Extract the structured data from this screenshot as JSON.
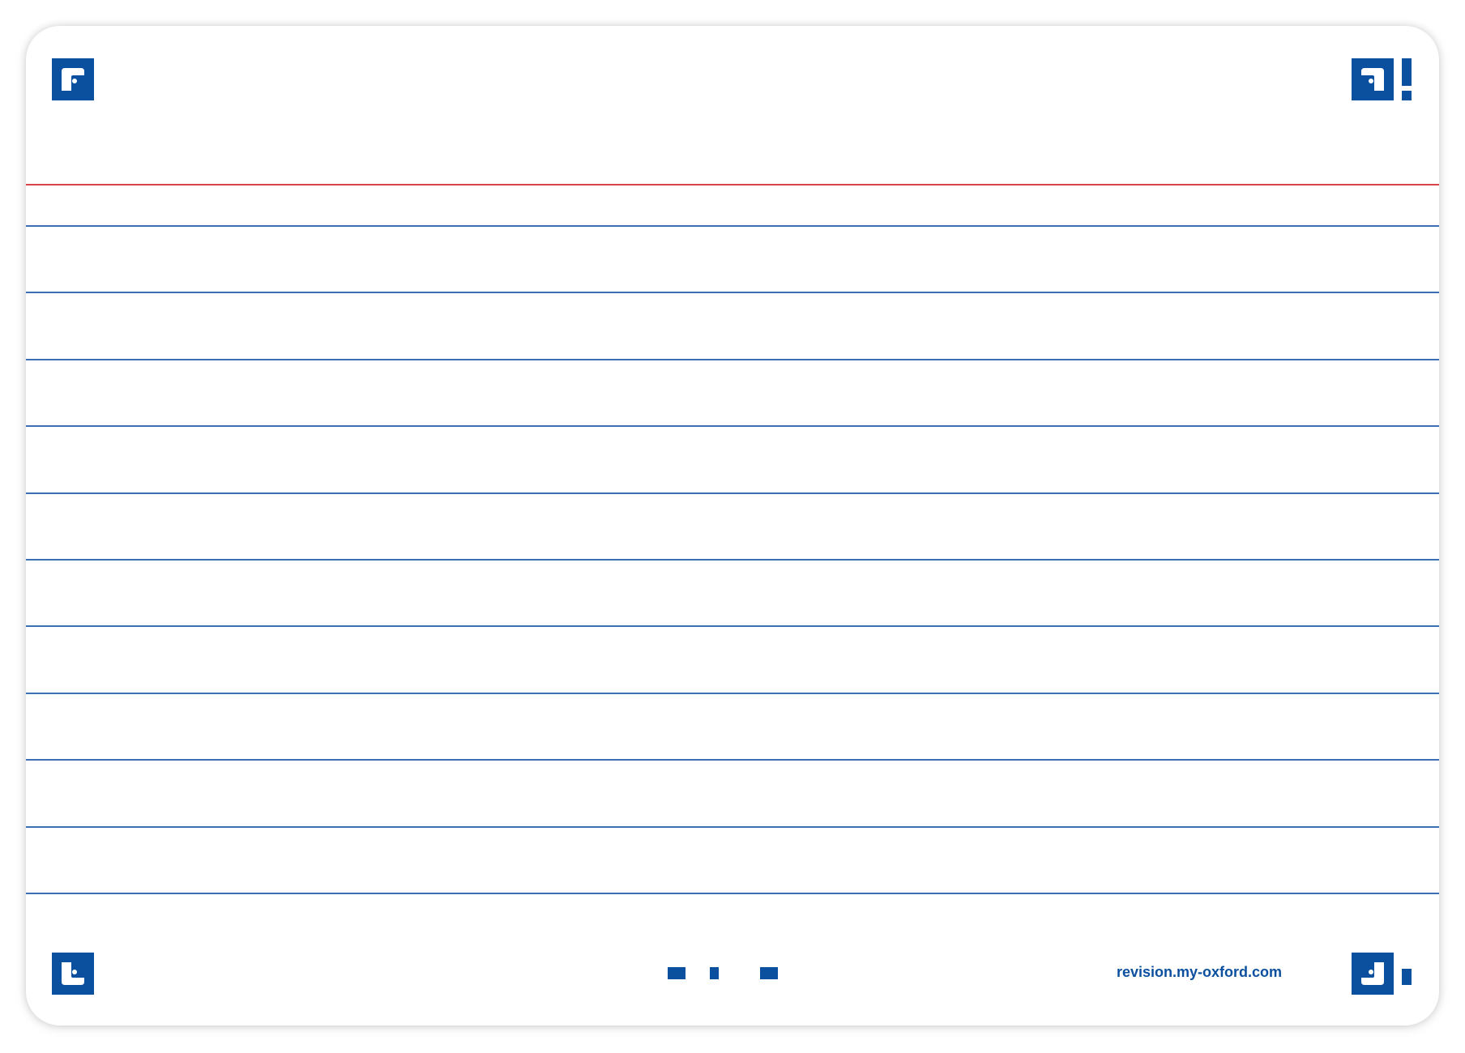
{
  "card": {
    "footer_url": "revision.my-oxford.com",
    "ruled_line_count": 11,
    "colors": {
      "brand_blue": "#0b4f9f",
      "header_rule": "#d9414b",
      "ruled_line": "#3f6fb3",
      "background": "#ffffff"
    }
  },
  "icons": {
    "top_left": "corner-bracket-top-left-icon",
    "top_right": "corner-bracket-top-right-exclamation-icon",
    "bottom_left": "corner-bracket-bottom-left-icon",
    "bottom_right": "corner-bracket-bottom-right-exclamation-icon",
    "bottom_center": "dot-pattern-icon"
  }
}
